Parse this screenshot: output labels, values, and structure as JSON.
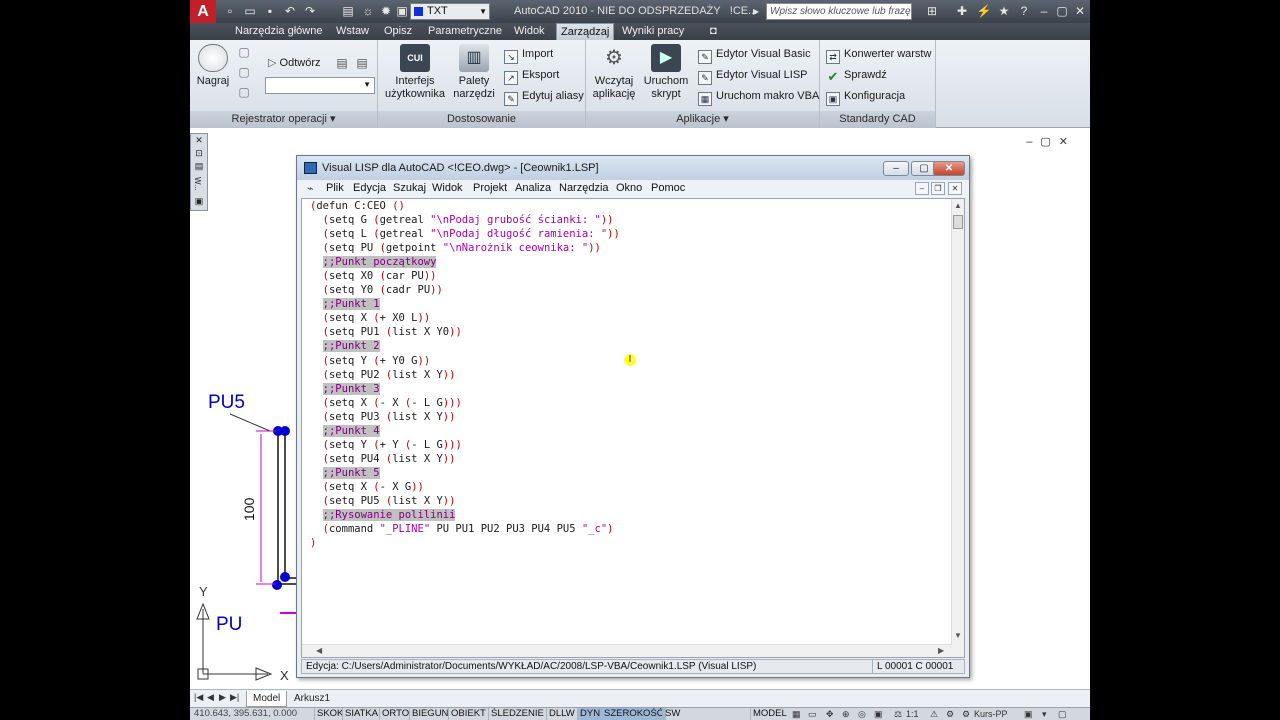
{
  "window": {
    "app_title": "AutoCAD 2010 - NIE DO ODSPRZEDAŻY",
    "file_name": "!CE...",
    "layer_combo": "TXT",
    "search_placeholder": "Wpisz słowo kluczowe lub frazę",
    "logo": "A"
  },
  "tabs": [
    "Narzędzia główne",
    "Wstaw",
    "Opisz",
    "Parametryczne",
    "Widok",
    "Zarządzaj",
    "Wyniki pracy"
  ],
  "active_tab": "Zarządzaj",
  "ribbon": {
    "recorder": {
      "record_label": "Nagraj",
      "play_label": "Odtwórz",
      "panel_title": "Rejestrator operacji ▾"
    },
    "customize": {
      "cui_icon_text": "CUI",
      "cui_label_1": "Interfejs",
      "cui_label_2": "użytkownika",
      "palettes_label_1": "Palety",
      "palettes_label_2": "narzędzi",
      "import_label": "Import",
      "export_label": "Eksport",
      "aliases_label": "Edytuj aliasy",
      "panel_title": "Dostosowanie"
    },
    "apps": {
      "load_label_1": "Wczytaj",
      "load_label_2": "aplikację",
      "run_script_label_1": "Uruchom",
      "run_script_label_2": "skrypt",
      "vba_editor_label": "Edytor Visual Basic",
      "lisp_editor_label": "Edytor Visual LISP",
      "run_vba_label": "Uruchom makro VBA",
      "panel_title": "Aplikacje ▾"
    },
    "standards": {
      "layer_converter_label": "Konwerter  warstw",
      "check_label": "Sprawdź",
      "config_label": "Konfiguracja",
      "panel_title": "Standardy CAD"
    }
  },
  "palette_label": "W...",
  "drawing_labels": {
    "pu5": "PU5",
    "pu": "PU",
    "dim": "100",
    "y_axis": "Y",
    "x_axis": "X"
  },
  "vlisp": {
    "title": "Visual LISP dla AutoCAD <!CEO.dwg> - [Ceownik1.LSP]",
    "menu": [
      "Plik",
      "Edycja",
      "Szukaj",
      "Widok",
      "Projekt",
      "Analiza",
      "Narzędzia",
      "Okno",
      "Pomoc"
    ],
    "code": [
      [
        {
          "t": "(",
          "c": "p"
        },
        {
          "t": "defun C:CEO ",
          "c": "kw"
        },
        {
          "t": "()",
          "c": "p"
        }
      ],
      [
        {
          "t": "  ",
          "c": "kw"
        },
        {
          "t": "(",
          "c": "p"
        },
        {
          "t": "setq G ",
          "c": "kw"
        },
        {
          "t": "(",
          "c": "p"
        },
        {
          "t": "getreal ",
          "c": "kw"
        },
        {
          "t": "\"\\nPodaj grubość ścianki: \"",
          "c": "str"
        },
        {
          "t": "))",
          "c": "p"
        }
      ],
      [
        {
          "t": "  ",
          "c": "kw"
        },
        {
          "t": "(",
          "c": "p"
        },
        {
          "t": "setq L ",
          "c": "kw"
        },
        {
          "t": "(",
          "c": "p"
        },
        {
          "t": "getreal ",
          "c": "kw"
        },
        {
          "t": "\"\\nPodaj długość ramienia: \"",
          "c": "str"
        },
        {
          "t": "))",
          "c": "p"
        }
      ],
      [
        {
          "t": "  ",
          "c": "kw"
        },
        {
          "t": "(",
          "c": "p"
        },
        {
          "t": "setq PU ",
          "c": "kw"
        },
        {
          "t": "(",
          "c": "p"
        },
        {
          "t": "getpoint ",
          "c": "kw"
        },
        {
          "t": "\"\\nNarożnik ceownika: \"",
          "c": "str"
        },
        {
          "t": "))",
          "c": "p"
        }
      ],
      [
        {
          "t": "  ",
          "c": "kw"
        },
        {
          "t": ";;Punkt początkowy",
          "c": "cm"
        }
      ],
      [
        {
          "t": "  ",
          "c": "kw"
        },
        {
          "t": "(",
          "c": "p"
        },
        {
          "t": "setq X0 ",
          "c": "kw"
        },
        {
          "t": "(",
          "c": "p"
        },
        {
          "t": "car PU",
          "c": "kw"
        },
        {
          "t": "))",
          "c": "p"
        }
      ],
      [
        {
          "t": "  ",
          "c": "kw"
        },
        {
          "t": "(",
          "c": "p"
        },
        {
          "t": "setq Y0 ",
          "c": "kw"
        },
        {
          "t": "(",
          "c": "p"
        },
        {
          "t": "cadr PU",
          "c": "kw"
        },
        {
          "t": "))",
          "c": "p"
        }
      ],
      [
        {
          "t": "  ",
          "c": "kw"
        },
        {
          "t": ";;Punkt 1",
          "c": "cm"
        }
      ],
      [
        {
          "t": "  ",
          "c": "kw"
        },
        {
          "t": "(",
          "c": "p"
        },
        {
          "t": "setq X ",
          "c": "kw"
        },
        {
          "t": "(",
          "c": "p"
        },
        {
          "t": "+ X0 L",
          "c": "kw"
        },
        {
          "t": "))",
          "c": "p"
        }
      ],
      [
        {
          "t": "  ",
          "c": "kw"
        },
        {
          "t": "(",
          "c": "p"
        },
        {
          "t": "setq PU1 ",
          "c": "kw"
        },
        {
          "t": "(",
          "c": "p"
        },
        {
          "t": "list X Y0",
          "c": "kw"
        },
        {
          "t": "))",
          "c": "p"
        }
      ],
      [
        {
          "t": "  ",
          "c": "kw"
        },
        {
          "t": ";;Punkt 2",
          "c": "cm"
        }
      ],
      [
        {
          "t": "  ",
          "c": "kw"
        },
        {
          "t": "(",
          "c": "p"
        },
        {
          "t": "setq Y ",
          "c": "kw"
        },
        {
          "t": "(",
          "c": "p"
        },
        {
          "t": "+ Y0 G",
          "c": "kw"
        },
        {
          "t": "))",
          "c": "p"
        }
      ],
      [
        {
          "t": "  ",
          "c": "kw"
        },
        {
          "t": "(",
          "c": "p"
        },
        {
          "t": "setq PU2 ",
          "c": "kw"
        },
        {
          "t": "(",
          "c": "p"
        },
        {
          "t": "list X Y",
          "c": "kw"
        },
        {
          "t": "))",
          "c": "p"
        }
      ],
      [
        {
          "t": "  ",
          "c": "kw"
        },
        {
          "t": ";;Punkt 3",
          "c": "cm"
        }
      ],
      [
        {
          "t": "  ",
          "c": "kw"
        },
        {
          "t": "(",
          "c": "p"
        },
        {
          "t": "setq X ",
          "c": "kw"
        },
        {
          "t": "(",
          "c": "p"
        },
        {
          "t": "- X ",
          "c": "kw"
        },
        {
          "t": "(",
          "c": "p"
        },
        {
          "t": "- L G",
          "c": "kw"
        },
        {
          "t": ")))",
          "c": "p"
        }
      ],
      [
        {
          "t": "  ",
          "c": "kw"
        },
        {
          "t": "(",
          "c": "p"
        },
        {
          "t": "setq PU3 ",
          "c": "kw"
        },
        {
          "t": "(",
          "c": "p"
        },
        {
          "t": "list X Y",
          "c": "kw"
        },
        {
          "t": "))",
          "c": "p"
        }
      ],
      [
        {
          "t": "  ",
          "c": "kw"
        },
        {
          "t": ";;Punkt 4",
          "c": "cm"
        }
      ],
      [
        {
          "t": "  ",
          "c": "kw"
        },
        {
          "t": "(",
          "c": "p"
        },
        {
          "t": "setq Y ",
          "c": "kw"
        },
        {
          "t": "(",
          "c": "p"
        },
        {
          "t": "+ Y ",
          "c": "kw"
        },
        {
          "t": "(",
          "c": "p"
        },
        {
          "t": "- L G",
          "c": "kw"
        },
        {
          "t": ")))",
          "c": "p"
        }
      ],
      [
        {
          "t": "  ",
          "c": "kw"
        },
        {
          "t": "(",
          "c": "p"
        },
        {
          "t": "setq PU4 ",
          "c": "kw"
        },
        {
          "t": "(",
          "c": "p"
        },
        {
          "t": "list X Y",
          "c": "kw"
        },
        {
          "t": "))",
          "c": "p"
        }
      ],
      [
        {
          "t": "  ",
          "c": "kw"
        },
        {
          "t": ";;Punkt 5",
          "c": "cm"
        }
      ],
      [
        {
          "t": "  ",
          "c": "kw"
        },
        {
          "t": "(",
          "c": "p"
        },
        {
          "t": "setq X ",
          "c": "kw"
        },
        {
          "t": "(",
          "c": "p"
        },
        {
          "t": "- X G",
          "c": "kw"
        },
        {
          "t": "))",
          "c": "p"
        }
      ],
      [
        {
          "t": "  ",
          "c": "kw"
        },
        {
          "t": "(",
          "c": "p"
        },
        {
          "t": "setq PU5 ",
          "c": "kw"
        },
        {
          "t": "(",
          "c": "p"
        },
        {
          "t": "list X Y",
          "c": "kw"
        },
        {
          "t": "))",
          "c": "p"
        }
      ],
      [
        {
          "t": "  ",
          "c": "kw"
        },
        {
          "t": ";;Rysowanie polilinii",
          "c": "cm"
        }
      ],
      [
        {
          "t": "  ",
          "c": "kw"
        },
        {
          "t": "(",
          "c": "p"
        },
        {
          "t": "command ",
          "c": "kw"
        },
        {
          "t": "\"_PLINE\"",
          "c": "str"
        },
        {
          "t": " PU PU1 PU2 PU3 PU4 PU5 ",
          "c": "kw"
        },
        {
          "t": "\"_c\"",
          "c": "str"
        },
        {
          "t": ")",
          "c": "p"
        }
      ],
      [
        {
          "t": ")",
          "c": "p"
        }
      ]
    ],
    "status_path": "Edycja:  C:/Users/Administrator/Documents/WYKŁAD/AC/2008/LSP-VBA/Ceownik1.LSP  (Visual LISP)",
    "status_pos": "L 00001  C 00001"
  },
  "layout_tabs": [
    "Model",
    "Arkusz1"
  ],
  "active_layout": "Model",
  "statusbar": {
    "coords": "410.643, 395.631, 0.000",
    "toggles": [
      "SKOK",
      "SIATKA",
      "ORTO",
      "BIEGUN",
      "OBIEKT",
      "ŚLEDZENIE",
      "DLLW",
      "DYN",
      "SZEROKOŚĆ",
      "SW"
    ],
    "active_toggles": [
      "DYN",
      "SZEROKOŚĆ"
    ],
    "model_label": "MODEL",
    "scale": "1:1",
    "workspace": "Kurs-PP"
  },
  "colors": {
    "accent": "#c0202a",
    "drawing_blue": "#0000c8",
    "dim_magenta": "#d000d0"
  }
}
